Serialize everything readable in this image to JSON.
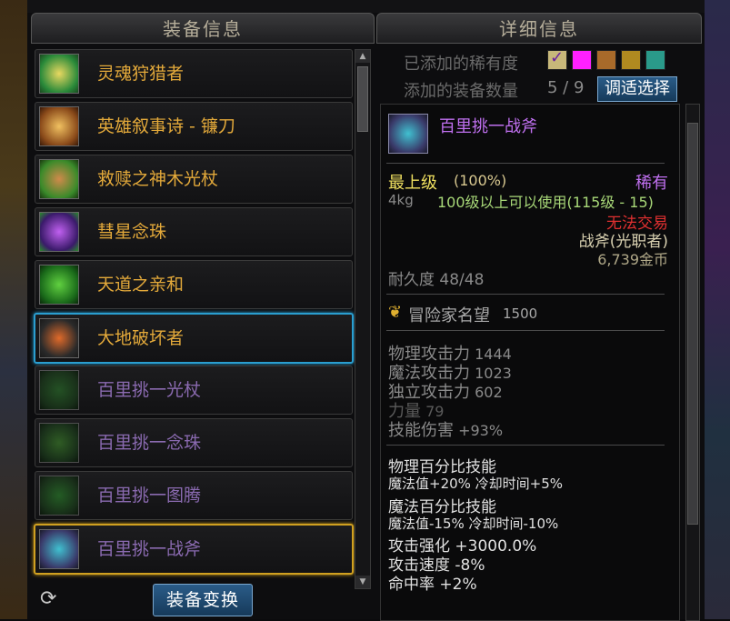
{
  "equip_panel": {
    "title": "装备信息",
    "items": [
      {
        "name": "灵魂狩猎者",
        "state": "normal"
      },
      {
        "name": "英雄叙事诗 - 镰刀",
        "state": "normal"
      },
      {
        "name": "救赎之神木光杖",
        "state": "normal"
      },
      {
        "name": "彗星念珠",
        "state": "normal"
      },
      {
        "name": "天道之亲和",
        "state": "normal"
      },
      {
        "name": "大地破坏者",
        "state": "selected-blue"
      },
      {
        "name": "百里挑一光杖",
        "state": "dim"
      },
      {
        "name": "百里挑一念珠",
        "state": "dim"
      },
      {
        "name": "百里挑一图腾",
        "state": "dim"
      },
      {
        "name": "百里挑一战斧",
        "state": "selected-gold"
      }
    ],
    "swap_button": "装备变换",
    "refresh_icon": "refresh-icon"
  },
  "detail_panel": {
    "title": "详细信息",
    "rarity_label": "已添加的稀有度",
    "rarity_swatches": [
      "#c8b87a",
      "#ff20ff",
      "#a86a2a",
      "#b08a20",
      "#2a9a8a"
    ],
    "count_label": "添加的装备数量",
    "count_value": "5 / 9",
    "adjust_button": "调适选择",
    "item": {
      "name": "百里挑一战斧",
      "grade": "最上级",
      "grade_pct": "(100%)",
      "rarity": "稀有",
      "weight": "4kg",
      "level_req": "100级以上可以使用(115级 - 15)",
      "trade": "无法交易",
      "type": "战斧(光职者)",
      "price": "6,739金币",
      "durability": "耐久度 48/48",
      "fame_label": "冒险家名望",
      "fame_value": "1500",
      "stats": [
        {
          "label": "物理攻击力",
          "value": "1444"
        },
        {
          "label": "魔法攻击力",
          "value": "1023"
        },
        {
          "label": "独立攻击力",
          "value": "602"
        },
        {
          "label": "力量",
          "value": "79"
        },
        {
          "label": "技能伤害",
          "value": "+93%"
        }
      ],
      "effects": [
        "物理百分比技能",
        " 魔法值+20% 冷却时间+5%",
        "魔法百分比技能",
        "  魔法值-15% 冷却时间-10%",
        "攻击强化 +3000.0%",
        "攻击速度 -8%",
        "命中率 +2%"
      ]
    }
  }
}
